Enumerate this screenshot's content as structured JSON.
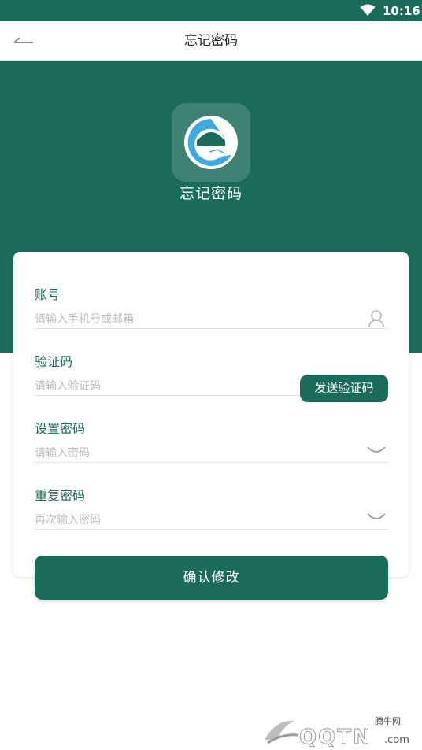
{
  "status_bar": {
    "time": "10:16",
    "wifi_icon": "wifi-icon"
  },
  "header": {
    "title": "忘记密码",
    "back_icon": "arrow-left-icon"
  },
  "hero": {
    "logo_icon": "handshake-logo-icon",
    "title": "忘记密码"
  },
  "form": {
    "account": {
      "label": "账号",
      "placeholder": "请输入手机号或邮箱",
      "value": "",
      "icon": "user-icon"
    },
    "code": {
      "label": "验证码",
      "placeholder": "请输入验证码",
      "value": "",
      "send_label": "发送验证码"
    },
    "password": {
      "label": "设置密码",
      "placeholder": "请输入密码",
      "value": "",
      "icon": "eye-closed-icon"
    },
    "repeat": {
      "label": "重复密码",
      "placeholder": "再次输入密码",
      "value": "",
      "icon": "eye-closed-icon"
    }
  },
  "confirm_label": "确认修改",
  "watermark": {
    "site": "腾牛网",
    "brand": "QQTN",
    "tld": ".com"
  },
  "colors": {
    "primary": "#1b6b5a",
    "logo_blue": "#3fa9e0",
    "text_dark": "#222222",
    "placeholder": "#bdbdbd"
  }
}
